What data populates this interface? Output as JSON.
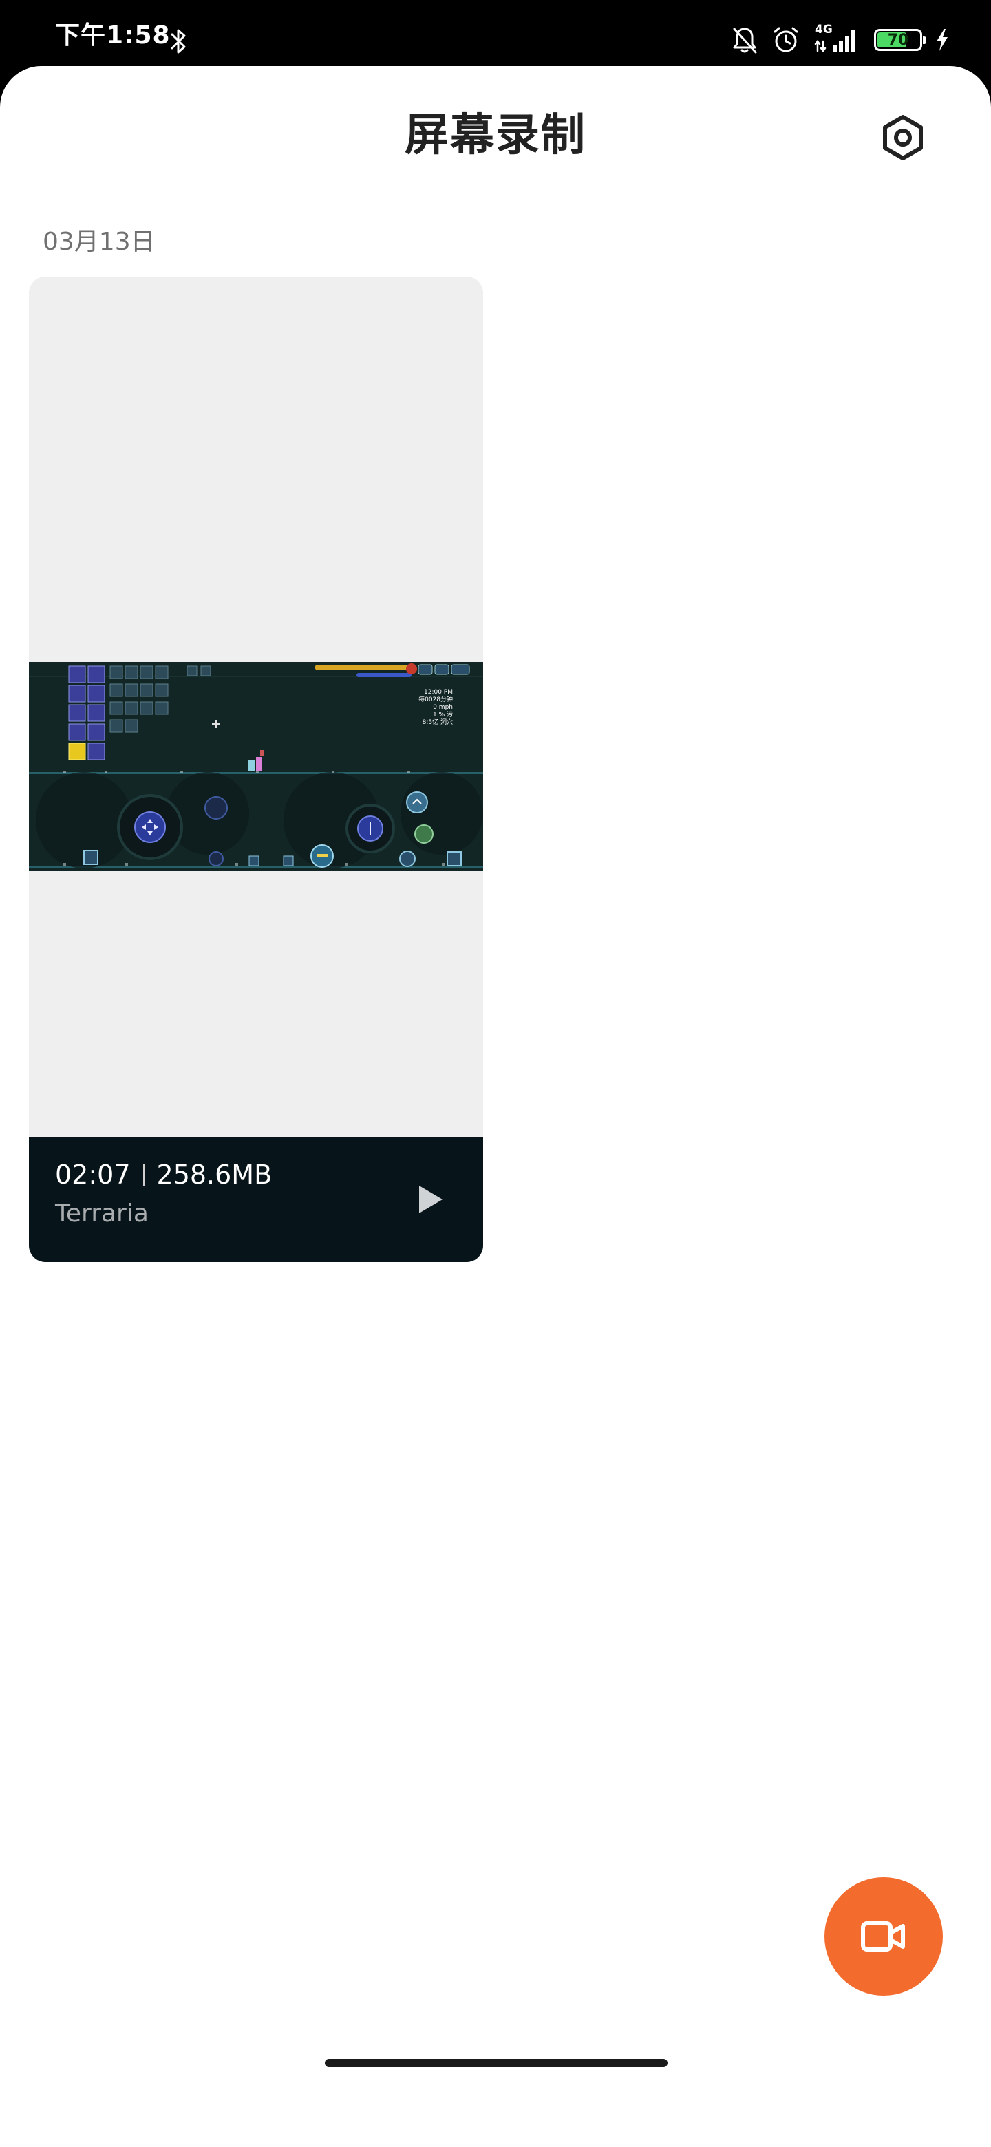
{
  "status_bar": {
    "time": "下午1:58",
    "network_label": "4G",
    "battery_level": "70",
    "battery_percent": 70
  },
  "header": {
    "title": "屏幕录制"
  },
  "recordings_group": {
    "date": "03月13日",
    "items": [
      {
        "duration": "02:07",
        "size": "258.6MB",
        "app_name": "Terraria"
      }
    ]
  },
  "thumbnail_hud": {
    "lines": [
      "12:00 PM",
      "每0028分钟",
      "0 mph",
      "1 % 污",
      "8:5亿 洞穴"
    ]
  },
  "colors": {
    "accent": "#f46b2e",
    "card_footer": "#071419",
    "battery_fill": "#4cd964"
  },
  "icons": {
    "settings": "hexagon-gear-icon",
    "play": "play-triangle-icon",
    "record": "video-camera-icon",
    "bluetooth": "bluetooth-icon",
    "mute": "bell-off-icon",
    "alarm": "alarm-clock-icon",
    "signal": "signal-bars-icon",
    "charging": "lightning-icon"
  }
}
